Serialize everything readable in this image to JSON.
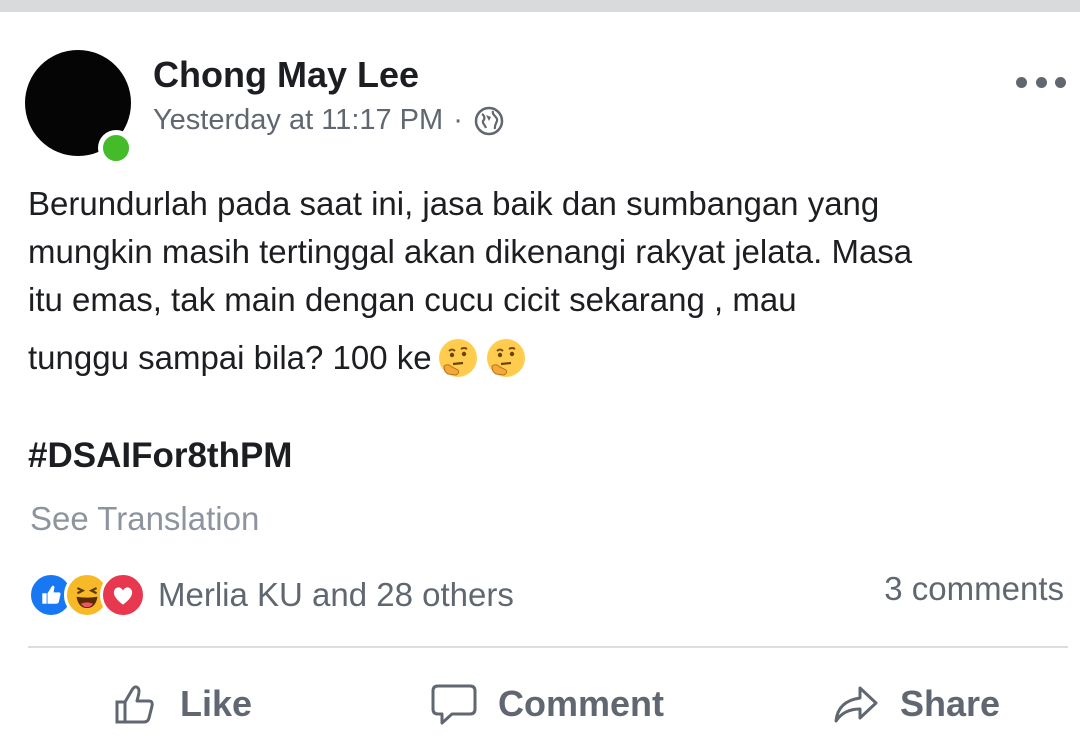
{
  "post": {
    "author": "Chong May Lee",
    "timestamp": "Yesterday at 11:17 PM",
    "separator": "·",
    "privacy_icon": "globe-icon",
    "text_lines": [
      "Berundurlah pada saat ini, jasa baik dan sumbangan yang",
      "mungkin masih tertinggal akan dikenangi rakyat jelata. Masa",
      "itu emas,  tak main dengan cucu cicit sekarang , mau",
      "tunggu sampai bila? 100 ke"
    ],
    "emojis": [
      "thinking-face-emoji",
      "thinking-face-emoji"
    ],
    "hashtag": "#DSAIFor8thPM",
    "see_translation": "See Translation"
  },
  "engagement": {
    "reaction_icons": [
      "like-reaction-icon",
      "haha-reaction-icon",
      "love-reaction-icon"
    ],
    "reactions_text": "Merlia KU and 28 others",
    "comments_text": "3 comments"
  },
  "actions": {
    "like": "Like",
    "comment": "Comment",
    "share": "Share"
  },
  "colors": {
    "online": "#44bb28",
    "like_blue": "#1877f2",
    "love_red": "#e8384f",
    "haha_yellow": "#f7b928",
    "text_primary": "#1c1e21",
    "text_secondary": "#606770"
  }
}
